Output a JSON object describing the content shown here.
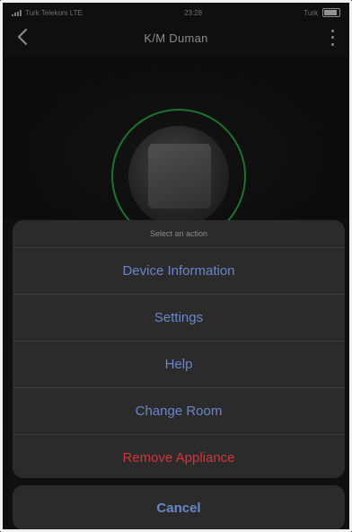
{
  "status_bar": {
    "carrier": "Turk Telekom  LTE",
    "time": "23:28",
    "right": "Turk"
  },
  "nav": {
    "title": "K/M Duman"
  },
  "action_sheet": {
    "title": "Select an action",
    "items": [
      {
        "label": "Device Information"
      },
      {
        "label": "Settings"
      },
      {
        "label": "Help"
      },
      {
        "label": "Change Room"
      },
      {
        "label": "Remove Appliance"
      }
    ],
    "cancel_label": "Cancel"
  },
  "colors": {
    "action_blue": "#6b86c9",
    "destructive_red": "#d9323a",
    "ring_green": "#2fae4a"
  },
  "icons": {
    "back": "chevron-left-icon",
    "more": "more-vertical-icon",
    "signal": "signal-icon",
    "battery": "battery-icon"
  }
}
